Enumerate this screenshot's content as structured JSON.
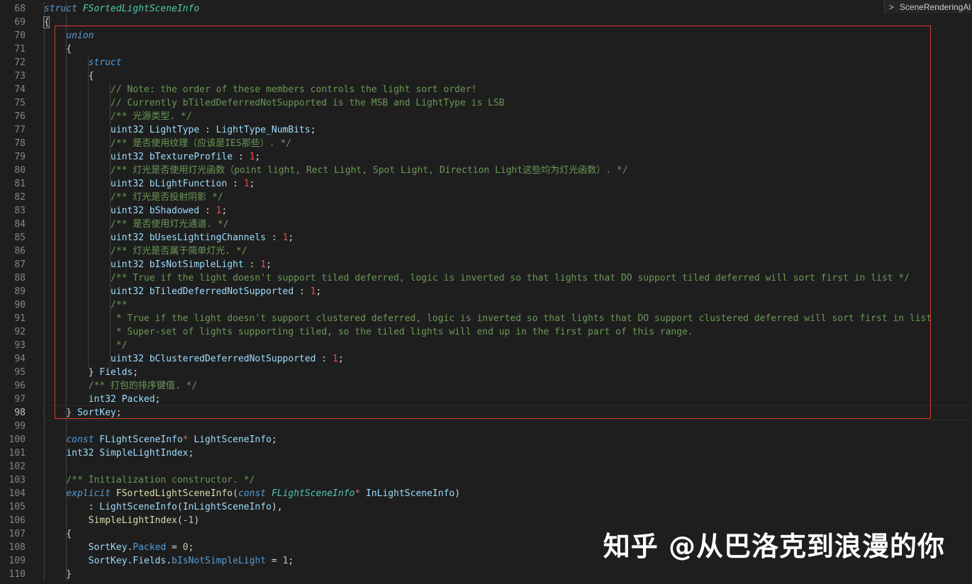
{
  "breadcrumb": {
    "chevron": ">",
    "label": "SceneRenderingAl"
  },
  "watermark": "知乎 @从巴洛克到浪漫的你",
  "colors": {
    "highlight_border": "#d33b2c",
    "background": "#1e1e1e"
  },
  "lines": [
    {
      "n": "68",
      "tokens": [
        [
          "kw",
          "struct"
        ],
        [
          "pn",
          " "
        ],
        [
          "ty",
          "FSortedLightSceneInfo"
        ]
      ]
    },
    {
      "n": "69",
      "tokens": [
        [
          "pn",
          "{"
        ]
      ]
    },
    {
      "n": "70",
      "tokens": [
        [
          "pn",
          "    "
        ],
        [
          "kw",
          "union"
        ]
      ]
    },
    {
      "n": "71",
      "tokens": [
        [
          "pn",
          "    {"
        ]
      ]
    },
    {
      "n": "72",
      "tokens": [
        [
          "pn",
          "        "
        ],
        [
          "kw",
          "struct"
        ]
      ]
    },
    {
      "n": "73",
      "tokens": [
        [
          "pn",
          "        {"
        ]
      ]
    },
    {
      "n": "74",
      "tokens": [
        [
          "pn",
          "            "
        ],
        [
          "cm",
          "// Note: the order of these members controls the light sort order!"
        ]
      ]
    },
    {
      "n": "75",
      "tokens": [
        [
          "pn",
          "            "
        ],
        [
          "cm",
          "// Currently bTiledDeferredNotSupported is the MSB and LightType is LSB"
        ]
      ]
    },
    {
      "n": "76",
      "tokens": [
        [
          "pn",
          "            "
        ],
        [
          "cm",
          "/** 光源类型. */"
        ]
      ]
    },
    {
      "n": "77",
      "tokens": [
        [
          "pn",
          "            "
        ],
        [
          "id",
          "uint32 LightType"
        ],
        [
          "pn",
          " : "
        ],
        [
          "id",
          "LightType_NumBits"
        ],
        [
          "pn",
          ";"
        ]
      ]
    },
    {
      "n": "78",
      "tokens": [
        [
          "pn",
          "            "
        ],
        [
          "cm",
          "/** 是否使用纹理（应该是IES那些）. */"
        ]
      ]
    },
    {
      "n": "79",
      "tokens": [
        [
          "pn",
          "            "
        ],
        [
          "id",
          "uint32 bTextureProfile"
        ],
        [
          "pn",
          " : "
        ],
        [
          "nm2",
          "1"
        ],
        [
          "pn",
          ";"
        ]
      ]
    },
    {
      "n": "80",
      "tokens": [
        [
          "pn",
          "            "
        ],
        [
          "cm",
          "/** 灯光是否使用灯光函数（point light, Rect Light, Spot Light, Direction Light这些均为灯光函数）. */"
        ]
      ]
    },
    {
      "n": "81",
      "tokens": [
        [
          "pn",
          "            "
        ],
        [
          "id",
          "uint32 bLightFunction"
        ],
        [
          "pn",
          " : "
        ],
        [
          "nm2",
          "1"
        ],
        [
          "pn",
          ";"
        ]
      ]
    },
    {
      "n": "82",
      "tokens": [
        [
          "pn",
          "            "
        ],
        [
          "cm",
          "/** 灯光是否投射阴影 */"
        ]
      ]
    },
    {
      "n": "83",
      "tokens": [
        [
          "pn",
          "            "
        ],
        [
          "id",
          "uint32 bShadowed"
        ],
        [
          "pn",
          " : "
        ],
        [
          "nm2",
          "1"
        ],
        [
          "pn",
          ";"
        ]
      ]
    },
    {
      "n": "84",
      "tokens": [
        [
          "pn",
          "            "
        ],
        [
          "cm",
          "/** 是否使用灯光通道. */"
        ]
      ]
    },
    {
      "n": "85",
      "tokens": [
        [
          "pn",
          "            "
        ],
        [
          "id",
          "uint32 bUsesLightingChannels"
        ],
        [
          "pn",
          " : "
        ],
        [
          "nm2",
          "1"
        ],
        [
          "pn",
          ";"
        ]
      ]
    },
    {
      "n": "86",
      "tokens": [
        [
          "pn",
          "            "
        ],
        [
          "cm",
          "/** 灯光是否属于简单灯光. */"
        ]
      ]
    },
    {
      "n": "87",
      "tokens": [
        [
          "pn",
          "            "
        ],
        [
          "id",
          "uint32 bIsNotSimpleLight"
        ],
        [
          "pn",
          " : "
        ],
        [
          "nm2",
          "1"
        ],
        [
          "pn",
          ";"
        ]
      ]
    },
    {
      "n": "88",
      "tokens": [
        [
          "pn",
          "            "
        ],
        [
          "cm",
          "/** True if the light doesn't support tiled deferred, logic is inverted so that lights that DO support tiled deferred will sort first in list */"
        ]
      ]
    },
    {
      "n": "89",
      "tokens": [
        [
          "pn",
          "            "
        ],
        [
          "id",
          "uint32 bTiledDeferredNotSupported"
        ],
        [
          "pn",
          " : "
        ],
        [
          "nm2",
          "1"
        ],
        [
          "pn",
          ";"
        ]
      ]
    },
    {
      "n": "90",
      "tokens": [
        [
          "pn",
          "            "
        ],
        [
          "cm",
          "/**"
        ]
      ]
    },
    {
      "n": "91",
      "tokens": [
        [
          "pn",
          "            "
        ],
        [
          "cm",
          " * True if the light doesn't support clustered deferred, logic is inverted so that lights that DO support clustered deferred will sort first in list"
        ]
      ]
    },
    {
      "n": "92",
      "tokens": [
        [
          "pn",
          "            "
        ],
        [
          "cm",
          " * Super-set of lights supporting tiled, so the tiled lights will end up in the first part of this range."
        ]
      ]
    },
    {
      "n": "93",
      "tokens": [
        [
          "pn",
          "            "
        ],
        [
          "cm",
          " */"
        ]
      ]
    },
    {
      "n": "94",
      "tokens": [
        [
          "pn",
          "            "
        ],
        [
          "id",
          "uint32 bClusteredDeferredNotSupported"
        ],
        [
          "pn",
          " : "
        ],
        [
          "nm2",
          "1"
        ],
        [
          "pn",
          ";"
        ]
      ]
    },
    {
      "n": "95",
      "tokens": [
        [
          "pn",
          "        } "
        ],
        [
          "id",
          "Fields"
        ],
        [
          "pn",
          ";"
        ]
      ]
    },
    {
      "n": "96",
      "tokens": [
        [
          "pn",
          "        "
        ],
        [
          "cm",
          "/** 打包的排序键值. */"
        ]
      ]
    },
    {
      "n": "97",
      "tokens": [
        [
          "pn",
          "        "
        ],
        [
          "id",
          "int32 Packed"
        ],
        [
          "pn",
          ";"
        ]
      ]
    },
    {
      "n": "98",
      "tokens": [
        [
          "pn",
          "    } "
        ],
        [
          "id",
          "SortKey"
        ],
        [
          "pn",
          ";"
        ]
      ],
      "current": true
    },
    {
      "n": "99",
      "tokens": []
    },
    {
      "n": "100",
      "tokens": [
        [
          "pn",
          "    "
        ],
        [
          "kw",
          "const"
        ],
        [
          "pn",
          " "
        ],
        [
          "id",
          "FLightSceneInfo"
        ],
        [
          "ptr",
          "*"
        ],
        [
          "pn",
          " "
        ],
        [
          "id",
          "LightSceneInfo"
        ],
        [
          "pn",
          ";"
        ]
      ]
    },
    {
      "n": "101",
      "tokens": [
        [
          "pn",
          "    "
        ],
        [
          "id",
          "int32 SimpleLightIndex"
        ],
        [
          "pn",
          ";"
        ]
      ]
    },
    {
      "n": "102",
      "tokens": []
    },
    {
      "n": "103",
      "tokens": [
        [
          "pn",
          "    "
        ],
        [
          "cm",
          "/** Initialization constructor. */"
        ]
      ]
    },
    {
      "n": "104",
      "tokens": [
        [
          "pn",
          "    "
        ],
        [
          "kw",
          "explicit"
        ],
        [
          "pn",
          " "
        ],
        [
          "fn",
          "FSortedLightSceneInfo"
        ],
        [
          "pn",
          "("
        ],
        [
          "kw",
          "const"
        ],
        [
          "pn",
          " "
        ],
        [
          "ty",
          "FLightSceneInfo"
        ],
        [
          "ptr",
          "*"
        ],
        [
          "pn",
          " "
        ],
        [
          "id",
          "InLightSceneInfo"
        ],
        [
          "pn",
          ")"
        ]
      ]
    },
    {
      "n": "105",
      "tokens": [
        [
          "pn",
          "        : "
        ],
        [
          "id",
          "LightSceneInfo"
        ],
        [
          "pn",
          "("
        ],
        [
          "id",
          "InLightSceneInfo"
        ],
        [
          "pn",
          "),"
        ]
      ]
    },
    {
      "n": "106",
      "tokens": [
        [
          "pn",
          "        "
        ],
        [
          "fn",
          "SimpleLightIndex"
        ],
        [
          "pn",
          "("
        ],
        [
          "nm",
          "-1"
        ],
        [
          "pn",
          ")"
        ]
      ]
    },
    {
      "n": "107",
      "tokens": [
        [
          "pn",
          "    {"
        ]
      ]
    },
    {
      "n": "108",
      "tokens": [
        [
          "pn",
          "        "
        ],
        [
          "id",
          "SortKey"
        ],
        [
          "pn",
          "."
        ],
        [
          "kwn",
          "Packed"
        ],
        [
          "pn",
          " = "
        ],
        [
          "nm",
          "0"
        ],
        [
          "pn",
          ";"
        ]
      ]
    },
    {
      "n": "109",
      "tokens": [
        [
          "pn",
          "        "
        ],
        [
          "id",
          "SortKey"
        ],
        [
          "pn",
          "."
        ],
        [
          "id",
          "Fields"
        ],
        [
          "pn",
          "."
        ],
        [
          "kwn",
          "bIsNotSimpleLight"
        ],
        [
          "pn",
          " = "
        ],
        [
          "nm",
          "1"
        ],
        [
          "pn",
          ";"
        ]
      ]
    },
    {
      "n": "110",
      "tokens": [
        [
          "pn",
          "    }"
        ]
      ]
    }
  ]
}
